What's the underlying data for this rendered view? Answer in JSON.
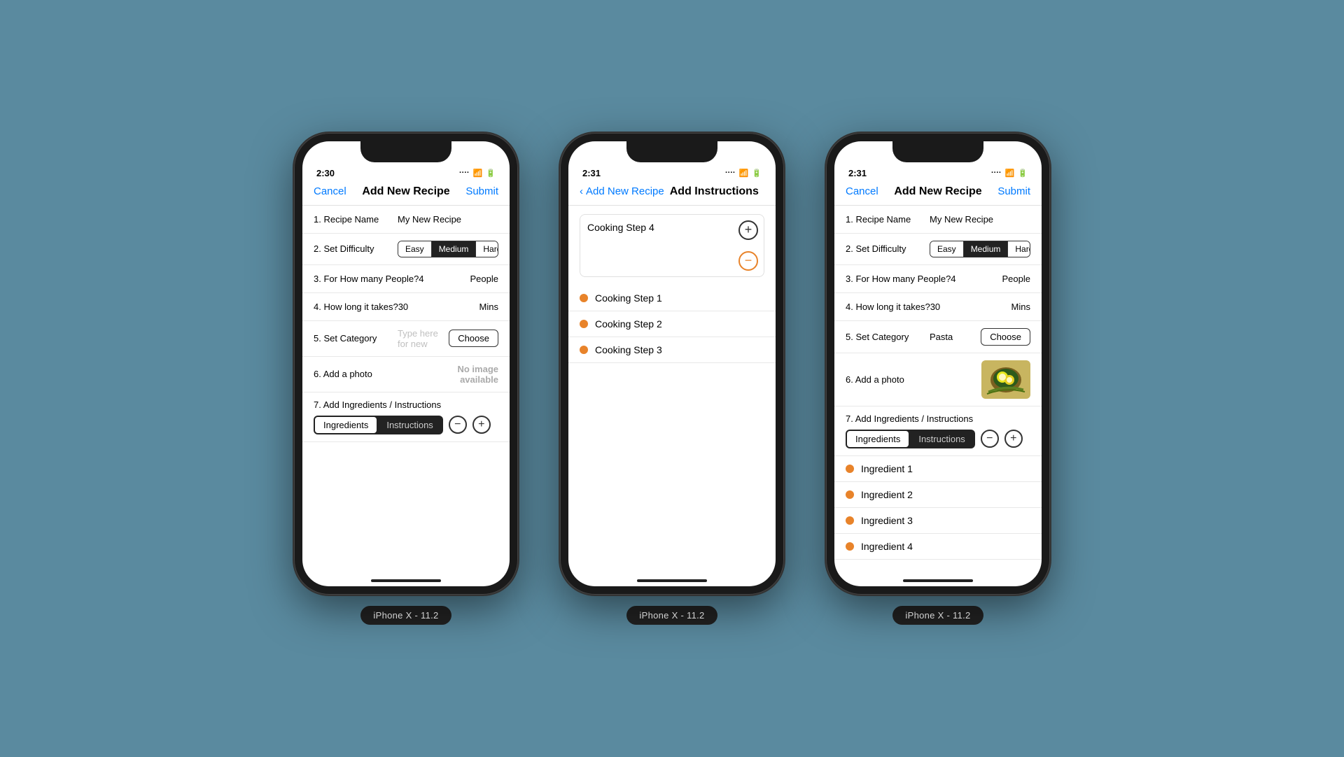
{
  "phones": [
    {
      "id": "phone1",
      "label": "iPhone X - 11.2",
      "time": "2:30",
      "screen": "add_recipe_empty",
      "nav": {
        "cancel": "Cancel",
        "title": "Add New Recipe",
        "submit": "Submit"
      },
      "fields": {
        "recipe_name_label": "1. Recipe Name",
        "recipe_name_value": "My New Recipe",
        "difficulty_label": "2. Set Difficulty",
        "difficulty_options": [
          "Easy",
          "Medium",
          "Hard"
        ],
        "difficulty_active": 1,
        "people_label": "3. For How many People?",
        "people_value": "4",
        "people_suffix": "People",
        "time_label": "4. How long it takes?",
        "time_value": "30",
        "time_suffix": "Mins",
        "category_label": "5. Set Category",
        "category_placeholder": "Type here for new",
        "category_choose": "Choose",
        "photo_label": "6. Add a photo",
        "photo_placeholder": "No image\navailable",
        "ingredients_label": "7. Add Ingredients / Instructions",
        "seg_ingredients": "Ingredients",
        "seg_instructions": "Instructions"
      }
    },
    {
      "id": "phone2",
      "label": "iPhone X - 11.2",
      "time": "2:31",
      "screen": "add_instructions",
      "nav": {
        "back_text": "Add New Recipe",
        "title": "Add Instructions"
      },
      "current_step": "Cooking Step 4",
      "steps": [
        "Cooking Step 1",
        "Cooking Step 2",
        "Cooking Step 3"
      ]
    },
    {
      "id": "phone3",
      "label": "iPhone X - 11.2",
      "time": "2:31",
      "screen": "add_recipe_filled",
      "nav": {
        "cancel": "Cancel",
        "title": "Add New Recipe",
        "submit": "Submit"
      },
      "fields": {
        "recipe_name_label": "1. Recipe Name",
        "recipe_name_value": "My New Recipe",
        "difficulty_label": "2. Set Difficulty",
        "difficulty_options": [
          "Easy",
          "Medium",
          "Hard"
        ],
        "difficulty_active": 1,
        "people_label": "3. For How many People?",
        "people_value": "4",
        "people_suffix": "People",
        "time_label": "4. How long it takes?",
        "time_value": "30",
        "time_suffix": "Mins",
        "category_label": "5. Set Category",
        "category_value": "Pasta",
        "category_choose": "Choose",
        "photo_label": "6. Add a photo",
        "ingredients_label": "7. Add Ingredients / Instructions",
        "seg_ingredients": "Ingredients",
        "seg_instructions": "Instructions",
        "ingredients": [
          "Ingredient 1",
          "Ingredient 2",
          "Ingredient 3",
          "Ingredient 4"
        ]
      }
    }
  ]
}
